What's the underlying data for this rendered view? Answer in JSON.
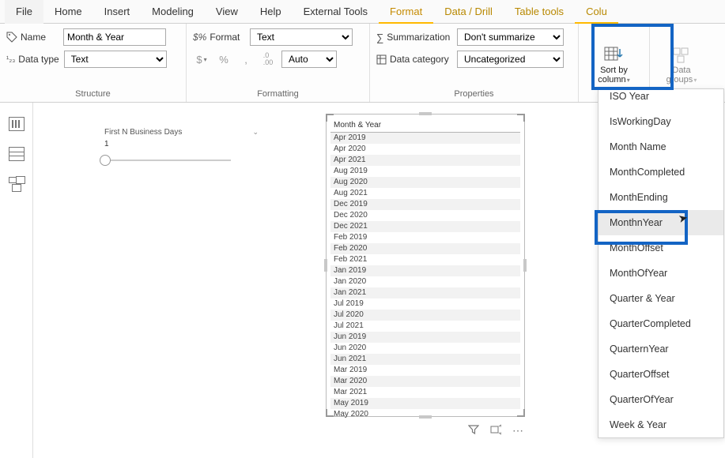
{
  "tabs": {
    "file": "File",
    "home": "Home",
    "insert": "Insert",
    "modeling": "Modeling",
    "view": "View",
    "help": "Help",
    "external": "External Tools",
    "format": "Format",
    "datadrill": "Data / Drill",
    "tabletools": "Table tools",
    "column": "Colu"
  },
  "ribbon": {
    "structure": {
      "title": "Structure",
      "name_label": "Name",
      "name_value": "Month & Year",
      "datatype_label": "Data type",
      "datatype_value": "Text"
    },
    "formatting": {
      "title": "Formatting",
      "format_label": "Format",
      "format_value": "Text",
      "currency": "$",
      "percent": "%",
      "comma": ",",
      "decimals_icon": ".00",
      "auto": "Auto"
    },
    "properties": {
      "title": "Properties",
      "summarization_label": "Summarization",
      "summarization_value": "Don't summarize",
      "datacategory_label": "Data category",
      "datacategory_value": "Uncategorized"
    },
    "sort": {
      "label_line1": "Sort by",
      "label_line2": "column"
    },
    "datagroups": {
      "label_line1": "Data",
      "label_line2": "groups"
    }
  },
  "slicer": {
    "title": "First N Business Days",
    "value": "1"
  },
  "table": {
    "header": "Month & Year",
    "rows": [
      "Apr 2019",
      "Apr 2020",
      "Apr 2021",
      "Aug 2019",
      "Aug 2020",
      "Aug 2021",
      "Dec 2019",
      "Dec 2020",
      "Dec 2021",
      "Feb 2019",
      "Feb 2020",
      "Feb 2021",
      "Jan 2019",
      "Jan 2020",
      "Jan 2021",
      "Jul 2019",
      "Jul 2020",
      "Jul 2021",
      "Jun 2019",
      "Jun 2020",
      "Jun 2021",
      "Mar 2019",
      "Mar 2020",
      "Mar 2021",
      "May 2019",
      "May 2020"
    ]
  },
  "sort_menu": {
    "items": [
      "ISO Year",
      "IsWorkingDay",
      "Month Name",
      "MonthCompleted",
      "MonthEnding",
      "MonthnYear",
      "MonthOffset",
      "MonthOfYear",
      "Quarter & Year",
      "QuarterCompleted",
      "QuarternYear",
      "QuarterOffset",
      "QuarterOfYear",
      "Week & Year"
    ]
  }
}
